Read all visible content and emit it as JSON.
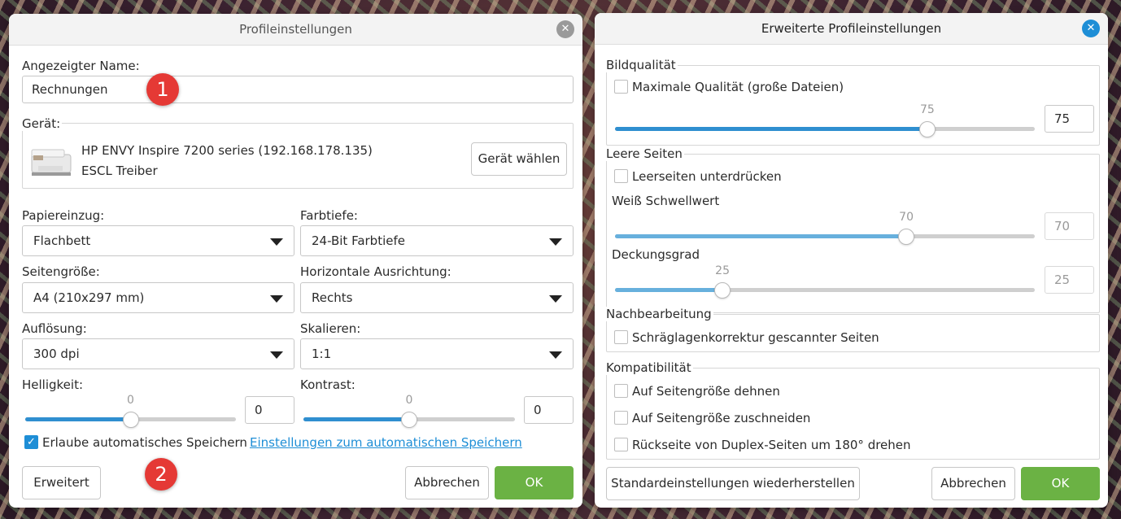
{
  "left": {
    "title": "Profileinstellungen",
    "name_label": "Angezeigter Name:",
    "name_value": "Rechnungen",
    "device_label": "Gerät:",
    "device_name": "HP ENVY Inspire 7200 series (192.168.178.135)",
    "device_driver": "ESCL Treiber",
    "choose_device": "Gerät wählen",
    "paper_label": "Papiereinzug:",
    "paper_value": "Flachbett",
    "color_label": "Farbtiefe:",
    "color_value": "24-Bit Farbtiefe",
    "size_label": "Seitengröße:",
    "size_value": "A4 (210x297 mm)",
    "align_label": "Horizontale Ausrichtung:",
    "align_value": "Rechts",
    "res_label": "Auflösung:",
    "res_value": "300 dpi",
    "scale_label": "Skalieren:",
    "scale_value": "1:1",
    "brightness_label": "Helligkeit:",
    "brightness_value": "0",
    "brightness_slider": "0",
    "contrast_label": "Kontrast:",
    "contrast_value": "0",
    "contrast_slider": "0",
    "autosave_label": "Erlaube automatisches Speichern",
    "autosave_checked": true,
    "autosave_link": "Einstellungen zum automatischen Speichern",
    "advanced_btn": "Erweitert",
    "cancel_btn": "Abbrechen",
    "ok_btn": "OK"
  },
  "right": {
    "title": "Erweiterte Profileinstellungen",
    "quality_group": "Bildqualität",
    "max_quality_label": "Maximale Qualität (große Dateien)",
    "quality_slider": "75",
    "quality_value": "75",
    "blank_group": "Leere Seiten",
    "suppress_blank_label": "Leerseiten unterdrücken",
    "white_threshold_label": "Weiß Schwellwert",
    "white_slider": "70",
    "white_value": "70",
    "coverage_label": "Deckungsgrad",
    "coverage_slider": "25",
    "coverage_value": "25",
    "post_group": "Nachbearbeitung",
    "deskew_label": "Schräglagenkorrektur gescannter Seiten",
    "compat_group": "Kompatibilität",
    "stretch_label": "Auf Seitengröße dehnen",
    "crop_label": "Auf Seitengröße zuschneiden",
    "rotate_label": "Rückseite von Duplex-Seiten um 180° drehen",
    "reset_btn": "Standardeinstellungen wiederherstellen",
    "cancel_btn": "Abbrechen",
    "ok_btn": "OK"
  },
  "markers": {
    "one": "1",
    "two": "2"
  },
  "colors": {
    "accent": "#1e8ed6",
    "ok_green": "#6bb244",
    "marker_red": "#e53935"
  }
}
